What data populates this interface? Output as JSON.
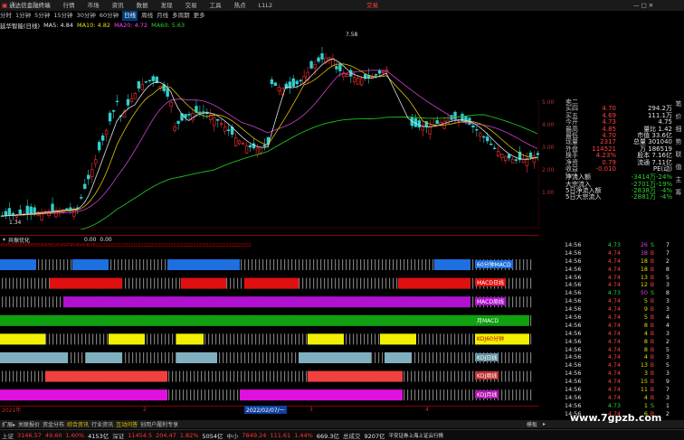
{
  "titlebar": {
    "app": "通达信金融终端",
    "menus": [
      "行情",
      "市场",
      "资讯",
      "数据",
      "发现",
      "交易",
      "工具",
      "热点",
      "L1L2"
    ],
    "right": "交易"
  },
  "periods": [
    "分时",
    "1分钟",
    "5分钟",
    "15分钟",
    "30分钟",
    "60分钟",
    "日线",
    "周线",
    "月线",
    "多周期",
    "更多"
  ],
  "stock": {
    "name": "延华智能(日线)",
    "ma5_label": "MA5: 4.84",
    "ma10_label": "MA10: 4.82",
    "ma20_label": "MA20: 4.72",
    "ma60_label": "MA60: 5.63",
    "high_mark": "7.58",
    "low_mark": "1.34"
  },
  "indicator": {
    "name": "共振优化",
    "value1": "0.00",
    "value2": "0.00"
  },
  "number_strip": "4545656565656565456565454547454545467822222222222222222222222222222222222222222222222222222222222222",
  "signal_rows": [
    {
      "label": "60分钟MACD",
      "color": "#1e6fe0"
    },
    {
      "label": "MACD日线",
      "color": "#e01010"
    },
    {
      "label": "MACD周线",
      "color": "#b010d0"
    },
    {
      "label": "月MACD",
      "color": "#10a010"
    },
    {
      "label": "KDJ60分钟",
      "color": "#f0f000"
    },
    {
      "label": "KDJ日线",
      "color": "#80b0c0"
    },
    {
      "label": "KDJ周线",
      "color": "#f04040"
    },
    {
      "label": "KDJ月线",
      "color": "#e010e0"
    }
  ],
  "date_bar": {
    "start": "2021年",
    "mid": "2022/02/07/一",
    "marks": [
      "2",
      "3",
      "4"
    ]
  },
  "bottom_tabs": [
    "扩展▸",
    "关联报价",
    "资金分布",
    "综合资讯",
    "行业资讯",
    "互动问答",
    "创用户履利专享"
  ],
  "bottom_tabs_right": [
    "模板",
    "▸"
  ],
  "index_bar": [
    {
      "name": "上证",
      "price": "3146.57",
      "chg": "49.60",
      "pct": "1.60%",
      "amt": "4153亿"
    },
    {
      "name": "深证",
      "price": "11454.5",
      "chg": "204.47",
      "pct": "1.82%",
      "amt": "5054亿"
    },
    {
      "name": "中小",
      "price": "7849.24",
      "chg": "111.61",
      "pct": "1.44%",
      "amt": "669.3亿"
    },
    {
      "name": "总成交",
      "price": "9207亿",
      "chg": "",
      "pct": "",
      "amt": ""
    }
  ],
  "index_tail": "平安证券上海上证云行情",
  "quote_panel": [
    {
      "k": "卖二",
      "v": "",
      "v2": ""
    },
    {
      "k": "买四",
      "v": "4.70",
      "v2": "294.2万"
    },
    {
      "k": "买五",
      "v": "4.69",
      "v2": "111.1万"
    },
    {
      "k": "今开",
      "v": "4.73",
      "v2": "4.75"
    },
    {
      "k": "最高",
      "v": "4.85",
      "v2": "量比 1.42"
    },
    {
      "k": "最低",
      "v": "4.70",
      "v2": "市值 33.6亿"
    },
    {
      "k": "现量",
      "v": "2317",
      "v2": "总量 301040"
    },
    {
      "k": "外盘",
      "v": "114521",
      "v2": "万 186519"
    },
    {
      "k": "换手",
      "v": "4.23%",
      "v2": "股本 7.16亿"
    },
    {
      "k": "净资",
      "v": "0.79",
      "v2": "流通 7.11亿"
    },
    {
      "k": "收益(一)",
      "v": "-0.010",
      "v2": "PE(动)"
    }
  ],
  "fund_flow": [
    {
      "k": "净流入额",
      "v": "-3414万",
      "pct": "-24%"
    },
    {
      "k": "大宗流入",
      "v": "-2701万",
      "pct": "-19%"
    },
    {
      "k": "5日净流入额",
      "v": "-2838万",
      "pct": "-4%"
    },
    {
      "k": "5日大宗流入",
      "v": "-2881万",
      "pct": "-4%"
    }
  ],
  "ticks": [
    {
      "t": "14:56",
      "p": "4.73",
      "v": "26",
      "d": "S",
      "n": "7"
    },
    {
      "t": "14:56",
      "p": "4.74",
      "v": "38",
      "d": "B",
      "n": "7"
    },
    {
      "t": "14:56",
      "p": "4.74",
      "v": "18",
      "d": "B",
      "n": "2"
    },
    {
      "t": "14:56",
      "p": "4.74",
      "v": "18",
      "d": "B",
      "n": "8"
    },
    {
      "t": "14:56",
      "p": "4.74",
      "v": "13",
      "d": "B",
      "n": "5"
    },
    {
      "t": "14:56",
      "p": "4.74",
      "v": "12",
      "d": "B",
      "n": "3"
    },
    {
      "t": "14:56",
      "p": "4.73",
      "v": "50",
      "d": "S",
      "n": "8"
    },
    {
      "t": "14:56",
      "p": "4.74",
      "v": "5",
      "d": "B",
      "n": "3"
    },
    {
      "t": "14:56",
      "p": "4.74",
      "v": "9",
      "d": "B",
      "n": "3"
    },
    {
      "t": "14:56",
      "p": "4.74",
      "v": "5",
      "d": "B",
      "n": "4"
    },
    {
      "t": "14:56",
      "p": "4.74",
      "v": "8",
      "d": "B",
      "n": "4"
    },
    {
      "t": "14:56",
      "p": "4.74",
      "v": "4",
      "d": "B",
      "n": "3"
    },
    {
      "t": "14:56",
      "p": "4.74",
      "v": "8",
      "d": "B",
      "n": "2"
    },
    {
      "t": "14:56",
      "p": "4.74",
      "v": "8",
      "d": "B",
      "n": "5"
    },
    {
      "t": "14:56",
      "p": "4.74",
      "v": "4",
      "d": "B",
      "n": "3"
    },
    {
      "t": "14:56",
      "p": "4.74",
      "v": "13",
      "d": "B",
      "n": "5"
    },
    {
      "t": "14:56",
      "p": "4.74",
      "v": "3",
      "d": "B",
      "n": "3"
    },
    {
      "t": "14:56",
      "p": "4.74",
      "v": "15",
      "d": "B",
      "n": "9"
    },
    {
      "t": "14:56",
      "p": "4.74",
      "v": "11",
      "d": "B",
      "n": "7"
    },
    {
      "t": "14:56",
      "p": "4.74",
      "v": "4",
      "d": "B",
      "n": "3"
    },
    {
      "t": "14:56",
      "p": "4.73",
      "v": "1",
      "d": "S",
      "n": "1"
    },
    {
      "t": "14:56",
      "p": "4.74",
      "v": "6",
      "d": "B",
      "n": "2"
    }
  ],
  "right_scale": [
    "5.00",
    "4.00",
    "3.00",
    "2.00",
    "1.00"
  ],
  "right_scale_low": [
    "4.00",
    "3.00"
  ],
  "vert_tabs": [
    "笔",
    "价",
    "细",
    "势",
    "联",
    "值",
    "主",
    "筹"
  ],
  "watermark": "www.7gpzb.com"
}
